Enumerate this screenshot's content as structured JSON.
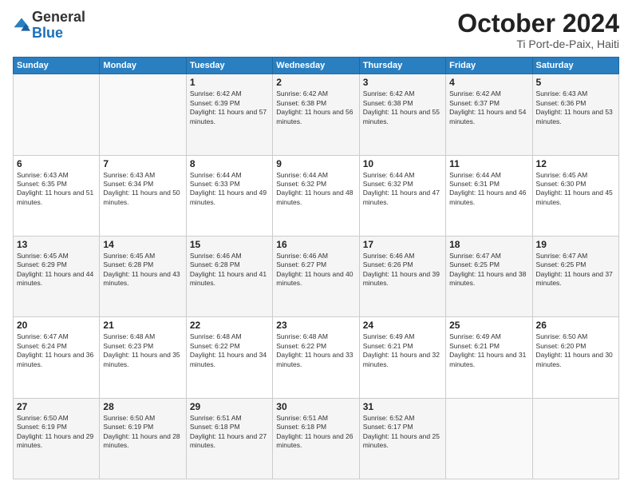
{
  "header": {
    "logo": {
      "line1": "General",
      "line2": "Blue"
    },
    "title": "October 2024",
    "subtitle": "Ti Port-de-Paix, Haiti"
  },
  "weekdays": [
    "Sunday",
    "Monday",
    "Tuesday",
    "Wednesday",
    "Thursday",
    "Friday",
    "Saturday"
  ],
  "weeks": [
    [
      {
        "day": "",
        "sunrise": "",
        "sunset": "",
        "daylight": ""
      },
      {
        "day": "",
        "sunrise": "",
        "sunset": "",
        "daylight": ""
      },
      {
        "day": "1",
        "sunrise": "Sunrise: 6:42 AM",
        "sunset": "Sunset: 6:39 PM",
        "daylight": "Daylight: 11 hours and 57 minutes."
      },
      {
        "day": "2",
        "sunrise": "Sunrise: 6:42 AM",
        "sunset": "Sunset: 6:38 PM",
        "daylight": "Daylight: 11 hours and 56 minutes."
      },
      {
        "day": "3",
        "sunrise": "Sunrise: 6:42 AM",
        "sunset": "Sunset: 6:38 PM",
        "daylight": "Daylight: 11 hours and 55 minutes."
      },
      {
        "day": "4",
        "sunrise": "Sunrise: 6:42 AM",
        "sunset": "Sunset: 6:37 PM",
        "daylight": "Daylight: 11 hours and 54 minutes."
      },
      {
        "day": "5",
        "sunrise": "Sunrise: 6:43 AM",
        "sunset": "Sunset: 6:36 PM",
        "daylight": "Daylight: 11 hours and 53 minutes."
      }
    ],
    [
      {
        "day": "6",
        "sunrise": "Sunrise: 6:43 AM",
        "sunset": "Sunset: 6:35 PM",
        "daylight": "Daylight: 11 hours and 51 minutes."
      },
      {
        "day": "7",
        "sunrise": "Sunrise: 6:43 AM",
        "sunset": "Sunset: 6:34 PM",
        "daylight": "Daylight: 11 hours and 50 minutes."
      },
      {
        "day": "8",
        "sunrise": "Sunrise: 6:44 AM",
        "sunset": "Sunset: 6:33 PM",
        "daylight": "Daylight: 11 hours and 49 minutes."
      },
      {
        "day": "9",
        "sunrise": "Sunrise: 6:44 AM",
        "sunset": "Sunset: 6:32 PM",
        "daylight": "Daylight: 11 hours and 48 minutes."
      },
      {
        "day": "10",
        "sunrise": "Sunrise: 6:44 AM",
        "sunset": "Sunset: 6:32 PM",
        "daylight": "Daylight: 11 hours and 47 minutes."
      },
      {
        "day": "11",
        "sunrise": "Sunrise: 6:44 AM",
        "sunset": "Sunset: 6:31 PM",
        "daylight": "Daylight: 11 hours and 46 minutes."
      },
      {
        "day": "12",
        "sunrise": "Sunrise: 6:45 AM",
        "sunset": "Sunset: 6:30 PM",
        "daylight": "Daylight: 11 hours and 45 minutes."
      }
    ],
    [
      {
        "day": "13",
        "sunrise": "Sunrise: 6:45 AM",
        "sunset": "Sunset: 6:29 PM",
        "daylight": "Daylight: 11 hours and 44 minutes."
      },
      {
        "day": "14",
        "sunrise": "Sunrise: 6:45 AM",
        "sunset": "Sunset: 6:28 PM",
        "daylight": "Daylight: 11 hours and 43 minutes."
      },
      {
        "day": "15",
        "sunrise": "Sunrise: 6:46 AM",
        "sunset": "Sunset: 6:28 PM",
        "daylight": "Daylight: 11 hours and 41 minutes."
      },
      {
        "day": "16",
        "sunrise": "Sunrise: 6:46 AM",
        "sunset": "Sunset: 6:27 PM",
        "daylight": "Daylight: 11 hours and 40 minutes."
      },
      {
        "day": "17",
        "sunrise": "Sunrise: 6:46 AM",
        "sunset": "Sunset: 6:26 PM",
        "daylight": "Daylight: 11 hours and 39 minutes."
      },
      {
        "day": "18",
        "sunrise": "Sunrise: 6:47 AM",
        "sunset": "Sunset: 6:25 PM",
        "daylight": "Daylight: 11 hours and 38 minutes."
      },
      {
        "day": "19",
        "sunrise": "Sunrise: 6:47 AM",
        "sunset": "Sunset: 6:25 PM",
        "daylight": "Daylight: 11 hours and 37 minutes."
      }
    ],
    [
      {
        "day": "20",
        "sunrise": "Sunrise: 6:47 AM",
        "sunset": "Sunset: 6:24 PM",
        "daylight": "Daylight: 11 hours and 36 minutes."
      },
      {
        "day": "21",
        "sunrise": "Sunrise: 6:48 AM",
        "sunset": "Sunset: 6:23 PM",
        "daylight": "Daylight: 11 hours and 35 minutes."
      },
      {
        "day": "22",
        "sunrise": "Sunrise: 6:48 AM",
        "sunset": "Sunset: 6:22 PM",
        "daylight": "Daylight: 11 hours and 34 minutes."
      },
      {
        "day": "23",
        "sunrise": "Sunrise: 6:48 AM",
        "sunset": "Sunset: 6:22 PM",
        "daylight": "Daylight: 11 hours and 33 minutes."
      },
      {
        "day": "24",
        "sunrise": "Sunrise: 6:49 AM",
        "sunset": "Sunset: 6:21 PM",
        "daylight": "Daylight: 11 hours and 32 minutes."
      },
      {
        "day": "25",
        "sunrise": "Sunrise: 6:49 AM",
        "sunset": "Sunset: 6:21 PM",
        "daylight": "Daylight: 11 hours and 31 minutes."
      },
      {
        "day": "26",
        "sunrise": "Sunrise: 6:50 AM",
        "sunset": "Sunset: 6:20 PM",
        "daylight": "Daylight: 11 hours and 30 minutes."
      }
    ],
    [
      {
        "day": "27",
        "sunrise": "Sunrise: 6:50 AM",
        "sunset": "Sunset: 6:19 PM",
        "daylight": "Daylight: 11 hours and 29 minutes."
      },
      {
        "day": "28",
        "sunrise": "Sunrise: 6:50 AM",
        "sunset": "Sunset: 6:19 PM",
        "daylight": "Daylight: 11 hours and 28 minutes."
      },
      {
        "day": "29",
        "sunrise": "Sunrise: 6:51 AM",
        "sunset": "Sunset: 6:18 PM",
        "daylight": "Daylight: 11 hours and 27 minutes."
      },
      {
        "day": "30",
        "sunrise": "Sunrise: 6:51 AM",
        "sunset": "Sunset: 6:18 PM",
        "daylight": "Daylight: 11 hours and 26 minutes."
      },
      {
        "day": "31",
        "sunrise": "Sunrise: 6:52 AM",
        "sunset": "Sunset: 6:17 PM",
        "daylight": "Daylight: 11 hours and 25 minutes."
      },
      {
        "day": "",
        "sunrise": "",
        "sunset": "",
        "daylight": ""
      },
      {
        "day": "",
        "sunrise": "",
        "sunset": "",
        "daylight": ""
      }
    ]
  ]
}
